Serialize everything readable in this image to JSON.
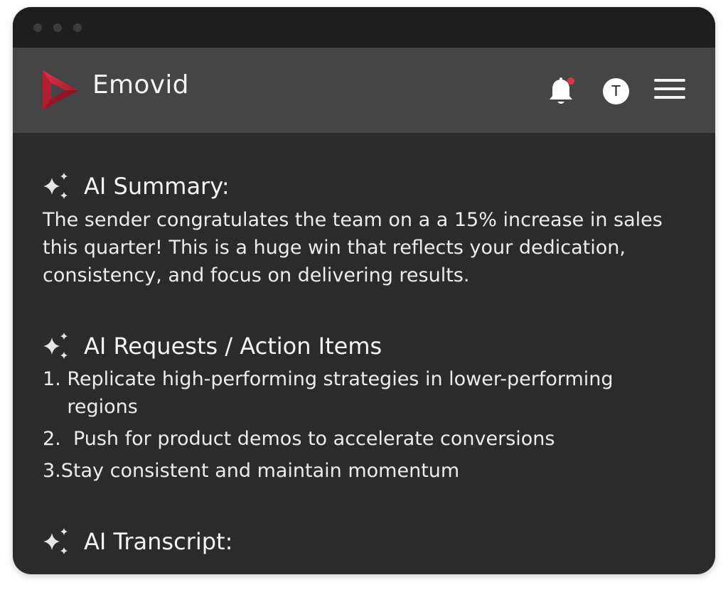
{
  "app": {
    "name": "Emovid",
    "avatar_letter": "T",
    "colors": {
      "brand": "#c0243a",
      "notification": "#e0334a",
      "window_bg": "#2b2b2b",
      "appbar_bg": "#454545",
      "titlebar_bg": "#1e1e1e"
    },
    "icons": {
      "logo": "emovid-logo-icon",
      "notification": "bell-icon",
      "menu": "hamburger-menu-icon",
      "section": "sparkle-icon"
    }
  },
  "sections": {
    "summary": {
      "title": "AI Summary:",
      "text": "The sender congratulates the team on a a 15% increase in sales this quarter! This is a huge win that reflects your dedication, consistency, and focus on delivering results."
    },
    "actions": {
      "title": "AI Requests / Action Items",
      "items": [
        {
          "num": "1. ",
          "text": "Replicate high-performing strategies in lower-performing regions"
        },
        {
          "num": "2.  ",
          "text": "Push for product demos to accelerate conversions"
        },
        {
          "num": "3.",
          "text": "Stay consistent and maintain momentum"
        }
      ]
    },
    "transcript": {
      "title": "AI Transcript:"
    }
  }
}
